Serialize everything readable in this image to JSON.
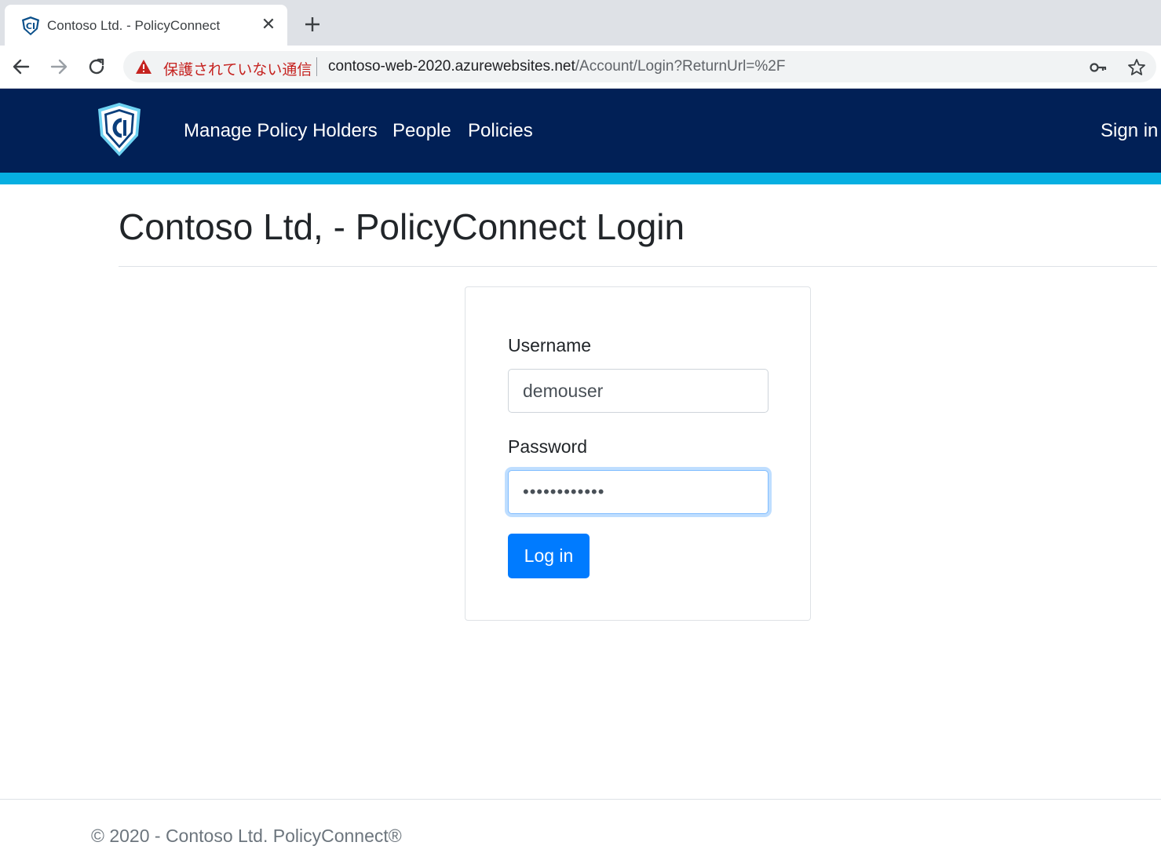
{
  "browser": {
    "tab": {
      "title": "Contoso Ltd. - PolicyConnect",
      "close_glyph": "✕",
      "favicon": "shield-logo-icon"
    },
    "new_tab_icon": "plus-icon",
    "toolbar": {
      "back_icon": "arrow-left-icon",
      "forward_icon": "arrow-right-icon",
      "reload_icon": "reload-icon"
    },
    "omnibox": {
      "security_warning": "保護されていない通信",
      "url_host": "contoso-web-2020.azurewebsites.net",
      "url_path": "/Account/Login?ReturnUrl=%2F",
      "warning_color": "#c5221f",
      "key_icon": "key-icon",
      "star_icon": "star-icon"
    }
  },
  "navbar": {
    "background_color": "#012056",
    "accent_color": "#06afe1",
    "logo_icon": "shield-logo-icon",
    "links": {
      "manage": "Manage Policy Holders",
      "people": "People",
      "policies": "Policies"
    },
    "sign_in": "Sign in"
  },
  "page": {
    "title": "Contoso Ltd, - PolicyConnect Login"
  },
  "login_form": {
    "username_label": "Username",
    "username_value": "demouser",
    "password_label": "Password",
    "password_value": "••••••••••••",
    "submit_label": "Log in",
    "button_color": "#007bff"
  },
  "footer": {
    "text": "© 2020 - Contoso Ltd. PolicyConnect®"
  }
}
